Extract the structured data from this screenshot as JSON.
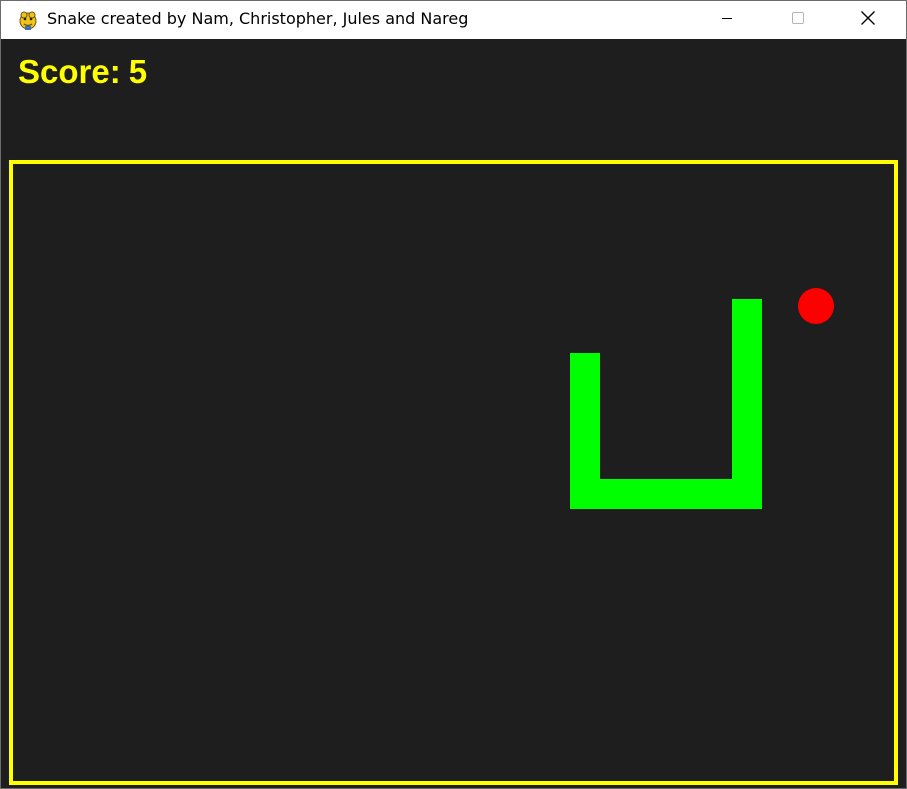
{
  "window": {
    "title": "Snake created by Nam, Christopher, Jules and Nareg",
    "app_icon": "pygame-snake-icon",
    "controls": {
      "minimize_icon": "minimize-icon",
      "maximize_icon": "maximize-icon",
      "close_icon": "close-icon"
    }
  },
  "game": {
    "score_label": "Score:",
    "score_value": "5",
    "colors": {
      "background": "#1e1e1e",
      "border": "#ffff00",
      "score_text": "#ffff00",
      "snake": "#00ff00",
      "food": "#ff0000"
    },
    "snake_color_name": "green",
    "food_color_name": "red"
  }
}
